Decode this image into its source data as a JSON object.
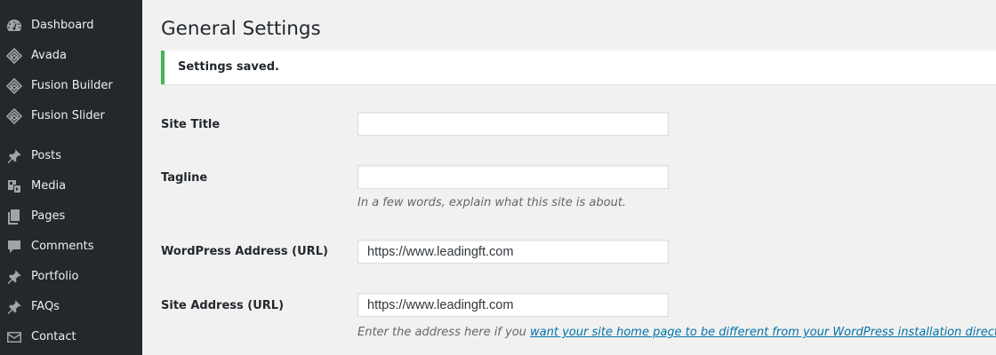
{
  "sidebar": {
    "items": [
      {
        "label": "Dashboard",
        "icon": "dashboard-icon"
      },
      {
        "label": "Avada",
        "icon": "avada-icon"
      },
      {
        "label": "Fusion Builder",
        "icon": "fusion-builder-icon"
      },
      {
        "label": "Fusion Slider",
        "icon": "fusion-slider-icon"
      },
      {
        "label": "Posts",
        "icon": "pushpin-icon"
      },
      {
        "label": "Media",
        "icon": "media-icon"
      },
      {
        "label": "Pages",
        "icon": "pages-icon"
      },
      {
        "label": "Comments",
        "icon": "comment-icon"
      },
      {
        "label": "Portfolio",
        "icon": "pushpin-icon"
      },
      {
        "label": "FAQs",
        "icon": "pushpin-icon"
      },
      {
        "label": "Contact",
        "icon": "envelope-icon"
      }
    ]
  },
  "main": {
    "title": "General Settings",
    "notice": "Settings saved.",
    "fields": {
      "site_title": {
        "label": "Site Title",
        "value": ""
      },
      "tagline": {
        "label": "Tagline",
        "value": "",
        "description": "In a few words, explain what this site is about."
      },
      "wp_address": {
        "label": "WordPress Address (URL)",
        "value": "https://www.leadingft.com"
      },
      "site_address": {
        "label": "Site Address (URL)",
        "value": "https://www.leadingft.com",
        "description_prefix": "Enter the address here if you ",
        "description_link": "want your site home page to be different from your WordPress installation directory",
        "description_suffix": "."
      }
    }
  },
  "colors": {
    "sidebar_bg": "#23282d",
    "notice_border": "#46b450",
    "link": "#0073aa"
  }
}
